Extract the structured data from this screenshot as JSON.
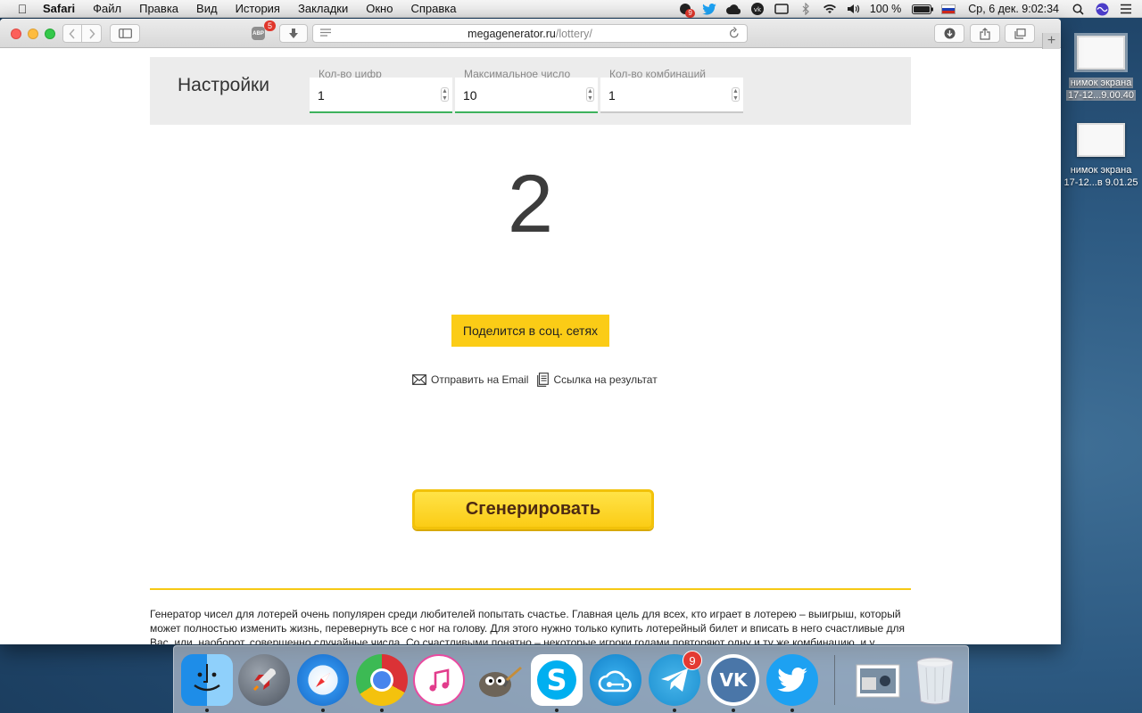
{
  "menubar": {
    "app": "Safari",
    "items": [
      "Файл",
      "Правка",
      "Вид",
      "История",
      "Закладки",
      "Окно",
      "Справка"
    ],
    "battery": "100 %",
    "clock": "Ср, 6 дек.  9:02:34",
    "notif_badge": "9"
  },
  "desktop": {
    "files": [
      {
        "line1": "нимок экрана",
        "line2": "17-12...9.00.40"
      },
      {
        "line1": "нимок экрана",
        "line2": "17-12...в 9.01.25"
      }
    ]
  },
  "browser": {
    "url_host": "megagenerator.ru",
    "url_path": "/lottery/",
    "abp_label": "ABP",
    "abp_count": "5"
  },
  "settings": {
    "title": "Настройки",
    "fields": [
      {
        "label": "Кол-во цифр",
        "value": "1"
      },
      {
        "label": "Максимальное число",
        "value": "10"
      },
      {
        "label": "Кол-во комбинаций",
        "value": "1"
      }
    ]
  },
  "result": {
    "value": "2"
  },
  "share": {
    "label": "Поделится в соц. сетях"
  },
  "links": {
    "email": "Отправить на Email",
    "result_link": "Ссылка на результат"
  },
  "generate": {
    "label": "Сгенерировать"
  },
  "description": "Генератор чисел для лотерей очень популярен среди любителей попытать счастье. Главная цель для всех, кто играет в лотерею – выигрыш, который может полностью изменить жизнь, перевернуть все с ног на голову. Для этого нужно только купить лотерейный билет и вписать в него счастливые для Вас, или, наоборот, совершенно случайные числа. Со счастливыми понятно – некоторые игроки годами повторяют одну и ту же комбинацию, и у",
  "dock": {
    "telegram_badge": "9",
    "apps": [
      "finder-icon",
      "launchpad-icon",
      "safari-icon",
      "chrome-icon",
      "itunes-icon",
      "gimp-icon",
      "skype-icon",
      "cloud-key-icon",
      "telegram-icon",
      "vk-icon",
      "twitter-icon",
      "photos-icon",
      "trash-icon"
    ]
  },
  "colors": {
    "accent_yellow": "#fbcc16",
    "focus_green": "#3db25c",
    "button_text": "#4d2a12"
  }
}
